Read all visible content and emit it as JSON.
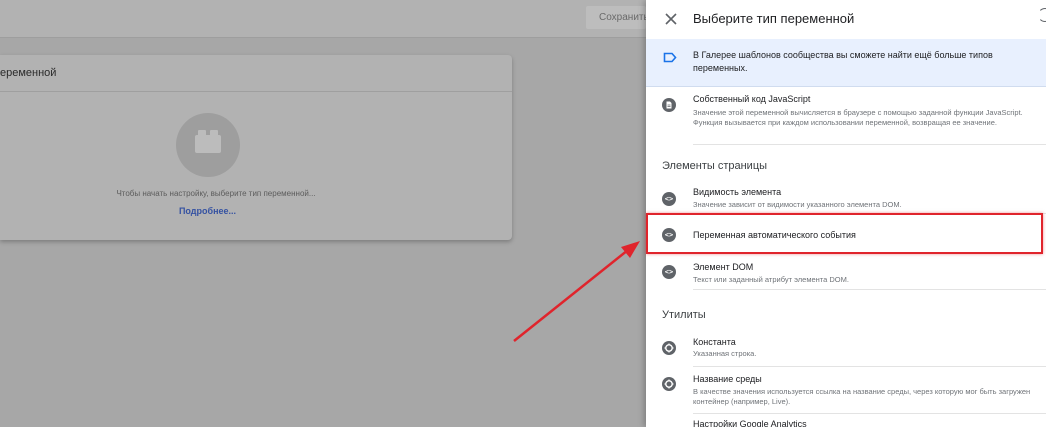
{
  "backdrop": {
    "save_label": "Сохранить",
    "card_title": "еременной",
    "card_text": "Чтобы начать настройку, выберите тип переменной...",
    "card_link": "Подробнее..."
  },
  "panel": {
    "title": "Выберите тип переменной",
    "info_text": "В Галерее шаблонов сообщества вы сможете найти ещё больше типов переменных.",
    "custom_js": {
      "title": "Собственный код JavaScript",
      "desc": "Значение этой переменной вычисляется в браузере с помощью заданной функции JavaScript. Функция вызывается при каждом использовании переменной, возвращая ее значение."
    },
    "section_page": "Элементы страницы",
    "element_visibility": {
      "title": "Видимость элемента",
      "desc": "Значение зависит от видимости указанного элемента DOM."
    },
    "auto_event": {
      "title": "Переменная автоматического события"
    },
    "dom_element": {
      "title": "Элемент DOM",
      "desc": "Текст или заданный атрибут элемента DOM."
    },
    "section_utils": "Утилиты",
    "constant": {
      "title": "Константа",
      "desc": "Указанная строка."
    },
    "env_name": {
      "title": "Название среды",
      "desc": "В качестве значения используется ссылка на название среды, через которую мог быть загружен контейнер (например, Live)."
    },
    "ga_settings": {
      "title": "Настройки Google Analytics"
    }
  },
  "colors": {
    "highlight": "#e0242c",
    "info_bg": "#e8f0fe",
    "info_icon": "#1a73e8",
    "link": "#3552a2"
  }
}
